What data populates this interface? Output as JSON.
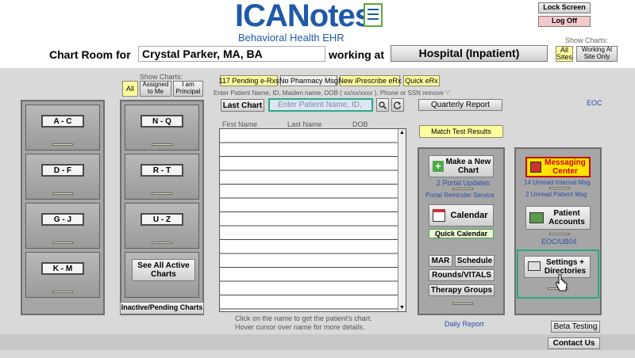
{
  "logo": {
    "brand": "ICANotes",
    "tagline": "Behavioral Health EHR"
  },
  "top_right": {
    "lock_screen": "Lock Screen",
    "log_off": "Log Off",
    "show_charts_label": "Show Charts:",
    "all_sites": "All Sites",
    "working_at_site_only": "Working At Site Only"
  },
  "header": {
    "chart_room_for": "Chart Room for",
    "user_name": "Crystal Parker, MA, BA",
    "working_at": "working at",
    "location": "Hospital (Inpatient)"
  },
  "filter": {
    "show_charts_label": "Show Charts:",
    "all": "All",
    "assigned_to_me": "Assigned to Me",
    "i_am_principal": "I am Principal"
  },
  "quick_buttons": {
    "pending_erx": "117 Pending e-Rxs",
    "no_pharmacy": "No Pharmacy Msg",
    "new_iprescribe": "New iPrescribe eRx",
    "quick_erx": "Quick eRx"
  },
  "search": {
    "hint": "Enter Patient Name, ID, Maiden name, DOB ( xx/xx/xxxx ), Phone or SSN remove '-'",
    "last_chart": "Last Chart",
    "placeholder": "Enter Patient Name, ID,",
    "quarterly_report": "Quarterly Report",
    "eoc": "EOC"
  },
  "table": {
    "col_first": "First Name",
    "col_last": "Last Name",
    "col_dob": "DOB",
    "footer_line1": "Click on the name to get the patient's chart.",
    "footer_line2": "Hover cursor over name for more details."
  },
  "cabinet_left": [
    "A - C",
    "D - F",
    "G - J",
    "K - M"
  ],
  "cabinet_mid": [
    "N - Q",
    "R - T",
    "U - Z"
  ],
  "see_all": "See All Active Charts",
  "inactive_pending": "Inactive/Pending Charts",
  "actions": {
    "match_test_results": "Match Test Results",
    "make_new_chart": "Make a New Chart",
    "portal_updates": "2 Portal Updates",
    "portal_reminder": "Portal Reminder Service",
    "calendar": "Calendar",
    "quick_calendar": "Quick Calendar",
    "mar": "MAR",
    "schedule": "Schedule",
    "rounds_vitals": "Rounds/VITALS",
    "therapy_groups": "Therapy Groups",
    "daily_report": "Daily Report"
  },
  "right_panel": {
    "messaging_center": "Messaging Center",
    "unread_internal": "14 Unread Internal Msg",
    "unread_patient": "2 Unread Patient Msg",
    "patient_accounts": "Patient Accounts",
    "eoc_ub04": "EOC/UB04",
    "settings_directories": "Settings + Directories"
  },
  "bottom": {
    "beta_testing": "Beta Testing",
    "contact_us": "Contact Us"
  },
  "colors": {
    "logo_blue": "#1f5aa8",
    "logo_green": "#5fa83a",
    "highlight_teal": "#2aa886",
    "log_off_pink": "#f4c9c9",
    "yellow_btn": "#ffffa0"
  }
}
